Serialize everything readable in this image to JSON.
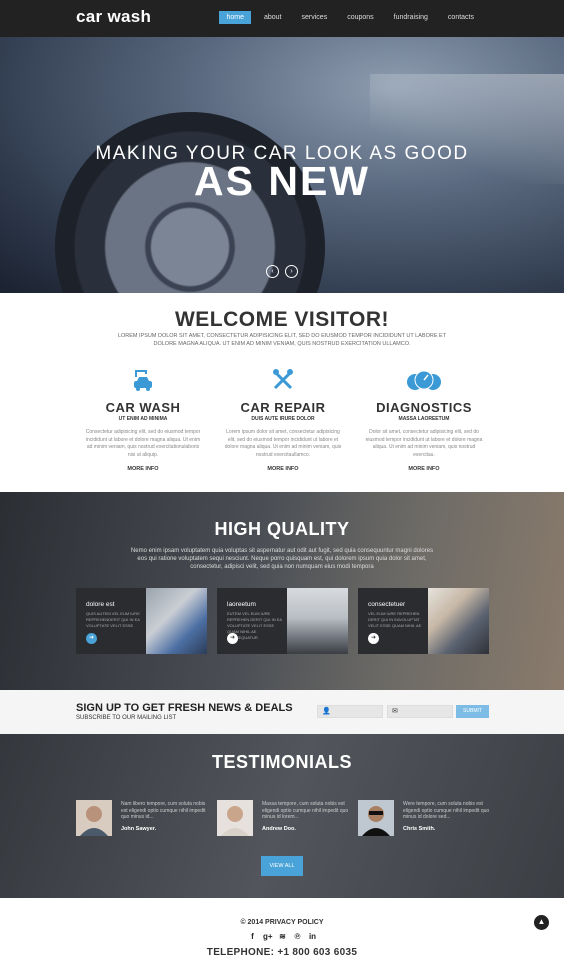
{
  "header": {
    "logo": "car wash",
    "nav": [
      "home",
      "about",
      "services",
      "coupons",
      "fundraising",
      "contacts"
    ],
    "active": "home"
  },
  "hero": {
    "line1": "MAKING YOUR CAR LOOK AS GOOD",
    "line2": "AS NEW",
    "prev": "‹",
    "next": "›"
  },
  "welcome": {
    "title": "WELCOME VISITOR!",
    "text": "LOREM IPSUM DOLOR SIT AMET, CONSECTETUR ADIPISICING ELIT, SED DO EIUSMOD TEMPOR INCIDIDUNT UT LABORE ET DOLORE MAGNA ALIQUA. UT ENIM AD MINIM VENIAM, QUIS NOSTRUD EXERCITATION ULLAMCO."
  },
  "services": [
    {
      "title": "CAR WASH",
      "subtitle": "UT ENIM AD MINIMA",
      "text": "Consectetur adipisicing elit, sed do eiusmod tempor incididunt ut labore et dolore magna aliqua. Ut enim ad minim veniam, quis nostrud exercitationulaboris nisi ut aliquip.",
      "more": "MORE INFO",
      "icon": "car-wash-icon"
    },
    {
      "title": "CAR REPAIR",
      "subtitle": "DUIS AUTE IRURE DOLOR",
      "text": "Lorem ipsum dolor sit amet, consectetur adipisicing elit, sed do eiusmod tempor incididunt ut labore et dolore magna aliqua. Ut enim ad minim veniam, quis nostrud exercitaullamco.",
      "more": "MORE INFO",
      "icon": "wrench-icon"
    },
    {
      "title": "DIAGNOSTICS",
      "subtitle": "MASSA LAOREETUM",
      "text": "Dolor sit amet, consectetur adipisicing elit, sed do eiusmod tempor incididunt ut labore et dolore magna aliqua. Ut enim ad minim veniam, quis nostrud exercitau.",
      "more": "MORE INFO",
      "icon": "gauge-icon"
    }
  ],
  "quality": {
    "title": "HIGH QUALITY",
    "text": "Nemo enim ipsam voluptatem quia voluptas sit aspernatur aut odit aut fugit, sed quia consequuntur magni dolores eos qui ratione voluptatem sequi nesciunt. Neque porro quisquam est, qui dolorem ipsum quia dolor sit amet, consectetur, adipisci velit, sed quia non numquam eius modi tempora",
    "cards": [
      {
        "title": "dolore est",
        "text": "QUIS AUTEM VEL EUM IURE REPREHENDERIT QUI IN EA VOLUPTATE VELIT ESSE"
      },
      {
        "title": "laoreetum",
        "text": "EUTEM VEL EUM IURE REPREHEN DERIT QUI IN EA VOLUPTATE VELIT ESSE QUAM NIHIL AE CONSEQUATUR"
      },
      {
        "title": "consectetuer",
        "text": "VEL EUM IURE REPREHEN DERIT QUI IN EAVOLUPTAT VELIT ESSE QUAM NIHIL AE"
      }
    ]
  },
  "newsletter": {
    "title": "SIGN UP TO GET FRESH NEWS & DEALS",
    "subtitle": "SUBSCRIBE TO OUR MAILING LIST",
    "submit": "SUBMIT"
  },
  "testimonials": {
    "title": "TESTIMONIALS",
    "items": [
      {
        "text": "Nam libero tempore, cum soluta nobis est eligendi optio cumque nihil impedit quo minus id...",
        "name": "John Sawyer."
      },
      {
        "text": "Massa tempore, cum soluta nobis est eligendi optio cumque nihil impedit quo minus id lorem...",
        "name": "Andrew Doo."
      },
      {
        "text": "Were tempore, cum soluta nobis est eligendi optio cumque nihil impedit quo minus id dolore sed...",
        "name": "Chris Smith."
      }
    ],
    "view_all": "VIEW ALL"
  },
  "footer": {
    "copyright": "© 2014 PRIVACY POLICY",
    "social": [
      "f",
      "g+",
      "rss",
      "p",
      "in"
    ],
    "telephone": "TELEPHONE: +1 800 603 6035"
  },
  "colors": {
    "accent": "#4aa3d8",
    "dark": "#222222"
  }
}
